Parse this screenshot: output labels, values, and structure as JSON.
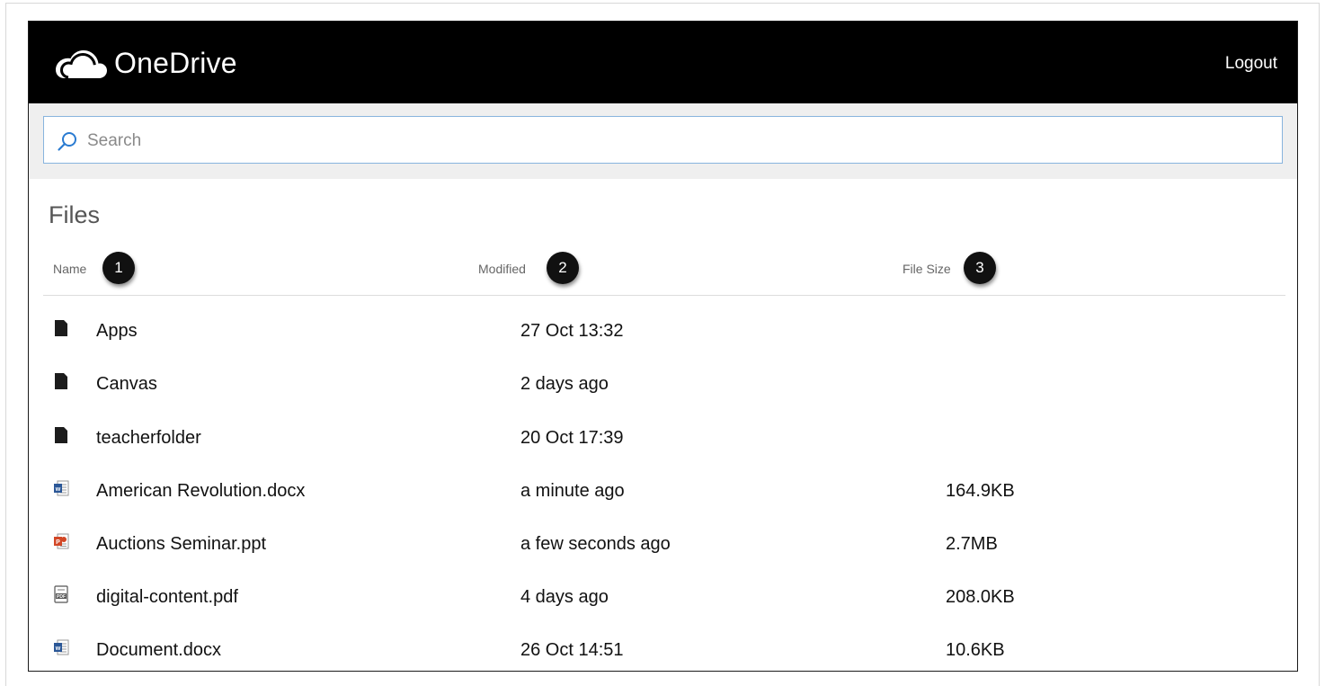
{
  "app": {
    "name": "OneDrive",
    "logout_label": "Logout"
  },
  "search": {
    "placeholder": "Search",
    "value": ""
  },
  "files": {
    "title": "Files",
    "columns": {
      "name": "Name",
      "modified": "Modified",
      "size": "File Size"
    },
    "badges": [
      "1",
      "2",
      "3"
    ],
    "rows": [
      {
        "icon": "folder-icon",
        "name": "Apps",
        "modified": "27 Oct 13:32",
        "size": ""
      },
      {
        "icon": "folder-icon",
        "name": "Canvas",
        "modified": "2 days ago",
        "size": ""
      },
      {
        "icon": "folder-icon",
        "name": "teacherfolder",
        "modified": "20 Oct 17:39",
        "size": ""
      },
      {
        "icon": "word-doc-icon",
        "name": "American Revolution.docx",
        "modified": "a minute ago",
        "size": "164.9KB"
      },
      {
        "icon": "powerpoint-icon",
        "name": "Auctions Seminar.ppt",
        "modified": "a few seconds ago",
        "size": "2.7MB"
      },
      {
        "icon": "pdf-icon",
        "name": "digital-content.pdf",
        "modified": "4 days ago",
        "size": "208.0KB"
      },
      {
        "icon": "word-doc-icon",
        "name": "Document.docx",
        "modified": "26 Oct 14:51",
        "size": "10.6KB"
      }
    ]
  },
  "colors": {
    "header_bg": "#000000",
    "search_border": "#88b4de",
    "search_icon": "#2a7bd1",
    "word_blue": "#2b5797",
    "ppt_orange": "#d24726"
  }
}
